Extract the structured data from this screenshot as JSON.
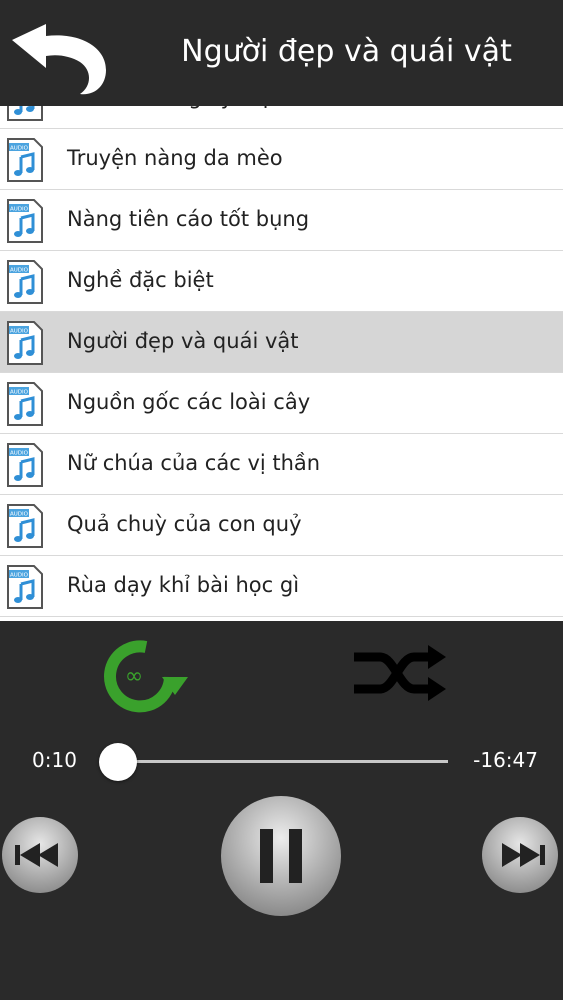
{
  "header": {
    "title": "Người đẹp và quái vật",
    "back_icon": "undo-arrow-icon"
  },
  "playlist": {
    "file_icon": "audio-file-icon",
    "selected_index": 4,
    "items": [
      {
        "label": "Mái tóc vàng kỳ diệu"
      },
      {
        "label": "Truyện nàng da mèo"
      },
      {
        "label": "Nàng tiên cáo tốt bụng"
      },
      {
        "label": "Nghề đặc biệt"
      },
      {
        "label": "Người đẹp và quái vật"
      },
      {
        "label": "Nguồn gốc các loài cây"
      },
      {
        "label": "Nữ chúa của các vị thần"
      },
      {
        "label": "Quả chuỳ của con quỷ"
      },
      {
        "label": "Rùa dạy khỉ bài học gì"
      }
    ]
  },
  "player": {
    "elapsed": "0:10",
    "remaining": "-16:47",
    "progress_fraction": 0.0,
    "repeat_icon": "repeat-infinite-icon",
    "shuffle_icon": "shuffle-icon",
    "prev_icon": "previous-track-icon",
    "play_icon": "pause-icon",
    "next_icon": "next-track-icon"
  },
  "colors": {
    "bar_background": "#2a2a2a",
    "accent_green": "#3aa12c",
    "selected_row": "#d6d6d6"
  }
}
